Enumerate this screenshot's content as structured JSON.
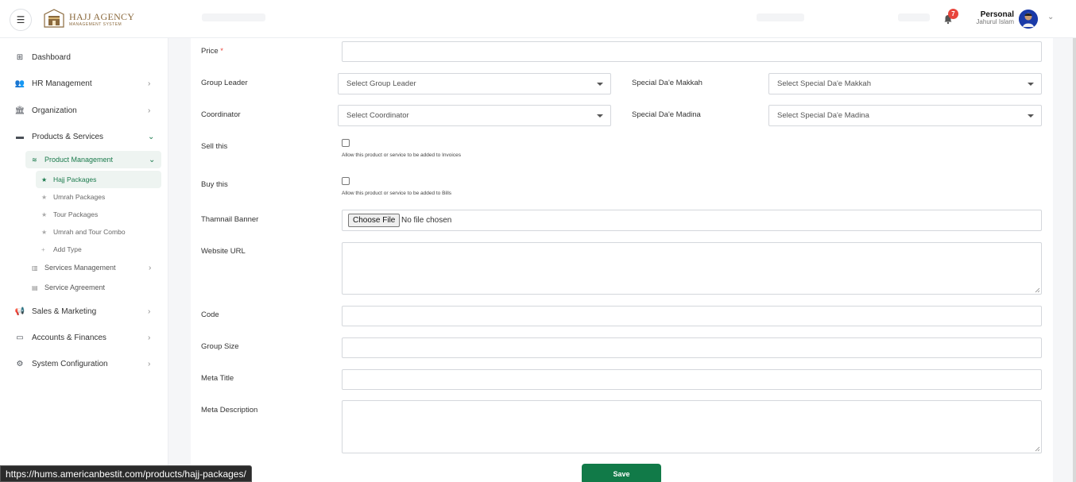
{
  "header": {
    "menu_icon": "hamburger-icon",
    "logo_title": "HAJJ AGENCY",
    "logo_subtitle": "MANAGEMENT SYSTEM",
    "notification_count": "7",
    "user_role": "Personal",
    "user_name": "Jahurul Islam"
  },
  "sidebar": {
    "items": [
      {
        "label": "Dashboard",
        "icon": "dashboard-icon"
      },
      {
        "label": "HR Management",
        "icon": "users-icon"
      },
      {
        "label": "Organization",
        "icon": "building-icon"
      },
      {
        "label": "Products & Services",
        "icon": "box-icon"
      },
      {
        "label": "Sales & Marketing",
        "icon": "megaphone-icon"
      },
      {
        "label": "Accounts & Finances",
        "icon": "card-icon"
      },
      {
        "label": "System Configuration",
        "icon": "gear-icon"
      }
    ],
    "product_management": "Product Management",
    "leaves": [
      "Hajj Packages",
      "Umrah Packages",
      "Tour Packages",
      "Umrah and Tour Combo",
      "Add Type"
    ],
    "services_management": "Services Management",
    "service_agreement": "Service Agreement"
  },
  "form": {
    "price_label": "Price",
    "required_mark": "*",
    "group_leader_label": "Group Leader",
    "group_leader_placeholder": "Select Group Leader",
    "special_makkah_label": "Special Da'e Makkah",
    "special_makkah_placeholder": "Select Special Da'e Makkah",
    "coordinator_label": "Coordinator",
    "coordinator_placeholder": "Select Coordinator",
    "special_madina_label": "Special Da'e Madina",
    "special_madina_placeholder": "Select Special Da'e Madina",
    "sell_label": "Sell this",
    "sell_help": "Allow this product or service to be added to Invoices",
    "buy_label": "Buy this",
    "buy_help": "Allow this product or service to be added to Bills",
    "banner_label": "Thamnail Banner",
    "file_button": "Choose File",
    "file_status": "No file chosen",
    "website_label": "Website URL",
    "code_label": "Code",
    "group_size_label": "Group Size",
    "meta_title_label": "Meta Title",
    "meta_desc_label": "Meta Description",
    "save_label": "Save"
  },
  "status_url": "https://hums.americanbestit.com/products/hajj-packages/",
  "colors": {
    "accent": "#117a48",
    "badge": "#e8453c",
    "logo": "#8b6a3e"
  }
}
